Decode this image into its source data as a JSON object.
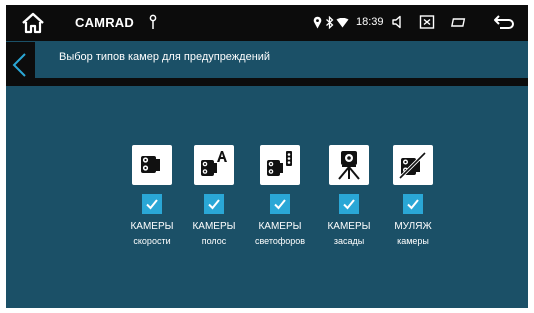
{
  "statusbar": {
    "app_name": "CAMRAD",
    "time": "18:39",
    "icons": [
      "home-icon",
      "usb-icon",
      "location-icon",
      "bluetooth-icon",
      "wifi-icon",
      "volume-icon",
      "screenshot-icon",
      "window-icon",
      "back-icon"
    ]
  },
  "header": {
    "title": "Выбор типов камер для предупреждений",
    "back_icon": "chevron-left-icon"
  },
  "cameras": [
    {
      "line1": "КАМЕРЫ",
      "line2": "скорости",
      "icon": "speed-camera-icon",
      "checked": true
    },
    {
      "line1": "КАМЕРЫ",
      "line2": "полос",
      "icon": "lane-camera-icon",
      "checked": true
    },
    {
      "line1": "КАМЕРЫ",
      "line2": "светофоров",
      "icon": "traffic-light-camera-icon",
      "checked": true
    },
    {
      "line1": "КАМЕРЫ",
      "line2": "засады",
      "icon": "ambush-camera-icon",
      "checked": true
    },
    {
      "line1": "МУЛЯЖ",
      "line2": "камеры",
      "icon": "dummy-camera-icon",
      "checked": true
    }
  ],
  "colors": {
    "background": "#1b5067",
    "bars": "#0c0c0c",
    "checkbox": "#2aa7d6",
    "text": "#ffffff"
  }
}
